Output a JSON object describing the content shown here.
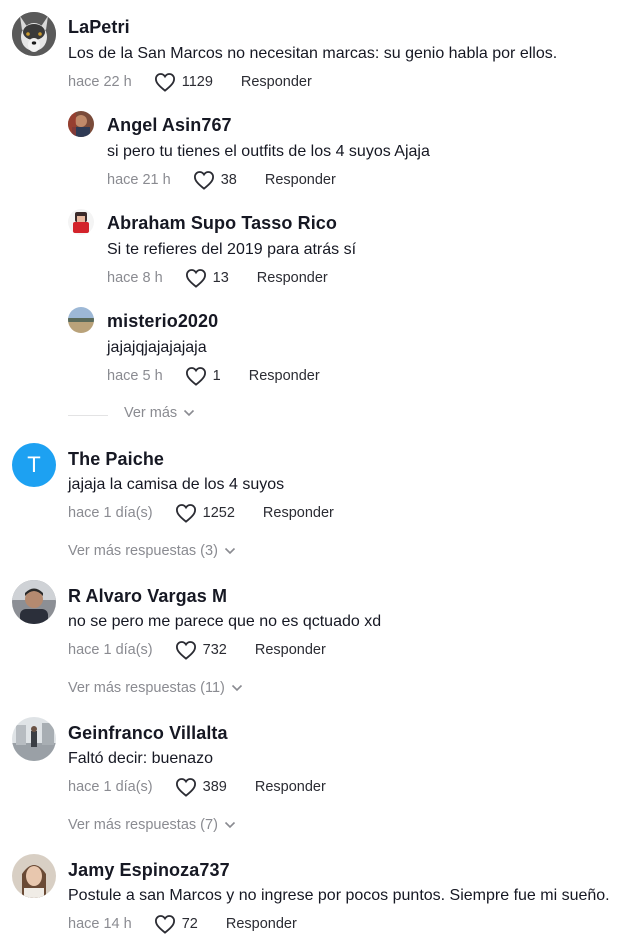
{
  "comments": [
    {
      "name": "LaPetri",
      "text": "Los de la San Marcos no necesitan marcas: su genio habla por ellos.",
      "time": "hace 22 h",
      "likes": "1129",
      "reply": "Responder",
      "avatar": "wolf-avatar",
      "replies": [
        {
          "name": "Angel Asin767",
          "text": "si pero tu tienes el outfits de los 4 suyos Ajaja",
          "time": "hace 21 h",
          "likes": "38",
          "reply": "Responder",
          "avatar": "photo-avatar"
        },
        {
          "name": "Abraham Supo Tasso Rico",
          "text": "Si te refieres del 2019 para atrás sí",
          "time": "hace 8 h",
          "likes": "13",
          "reply": "Responder",
          "avatar": "red-character-avatar"
        },
        {
          "name": "misterio2020",
          "text": "jajajqjajajajaja",
          "time": "hace 5 h",
          "likes": "1",
          "reply": "Responder",
          "avatar": "landscape-avatar"
        }
      ],
      "more_label": "Ver más"
    },
    {
      "name": "The Paiche",
      "text": "jajaja la camisa de los 4 suyos",
      "time": "hace 1 día(s)",
      "likes": "1252",
      "reply": "Responder",
      "avatar_letter": "T",
      "more_label": "Ver más respuestas (3)"
    },
    {
      "name": "R Alvaro Vargas M",
      "text": "no se pero me parece que no es qctuado xd",
      "time": "hace 1 día(s)",
      "likes": "732",
      "reply": "Responder",
      "more_label": "Ver más respuestas (11)"
    },
    {
      "name": "Geinfranco Villalta",
      "text": "Faltó decir: buenazo",
      "time": "hace 1 día(s)",
      "likes": "389",
      "reply": "Responder",
      "more_label": "Ver más respuestas (7)"
    },
    {
      "name": "Jamy Espinoza737",
      "text": "Postule a san Marcos y no ingrese por pocos puntos. Siempre fue mi sueño.",
      "time": "hace 14 h",
      "likes": "72",
      "reply": "Responder"
    }
  ],
  "colors": {
    "accent_blue": "#1DA1F2",
    "muted": "#8a8b91",
    "text": "#161823"
  }
}
